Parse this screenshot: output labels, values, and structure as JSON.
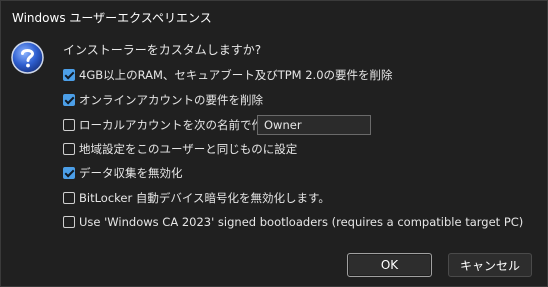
{
  "window": {
    "title": "Windows ユーザーエクスペリエンス"
  },
  "icon": "question-icon",
  "prompt": "インストーラーをカスタムしますか?",
  "options": [
    {
      "label": "4GB以上のRAM、セキュアブート及びTPM 2.0の要件を削除",
      "checked": true
    },
    {
      "label": "オンラインアカウントの要件を削除",
      "checked": true
    },
    {
      "label": "ローカルアカウントを次の名前で作成:",
      "checked": false
    },
    {
      "label": "地域設定をこのユーザーと同じものに設定",
      "checked": false
    },
    {
      "label": "データ収集を無効化",
      "checked": true
    },
    {
      "label": "BitLocker 自動デバイス暗号化を無効化します。",
      "checked": false
    },
    {
      "label": "Use 'Windows CA 2023' signed bootloaders (requires a compatible target PC)",
      "checked": false
    }
  ],
  "local_account_name": "Owner",
  "buttons": {
    "ok": "OK",
    "cancel": "キャンセル"
  },
  "colors": {
    "background": "#202020",
    "accent": "#4c9fe8"
  }
}
